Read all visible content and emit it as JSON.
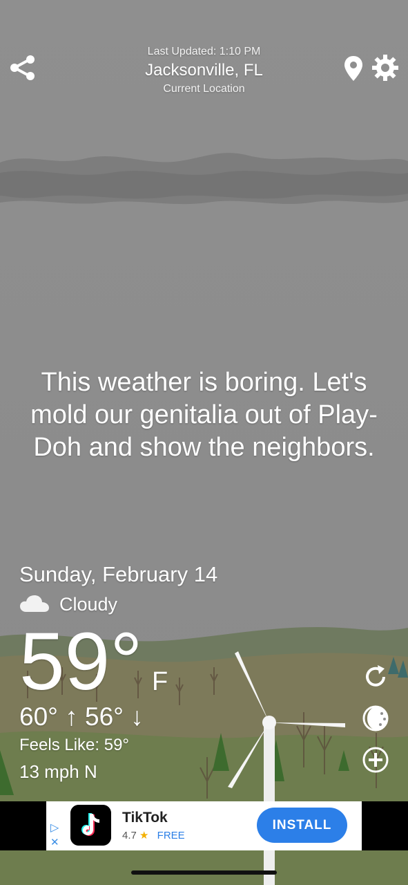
{
  "header": {
    "last_updated": "Last Updated: 1:10 PM",
    "city": "Jacksonville, FL",
    "location_label": "Current Location"
  },
  "icons": {
    "share": "share-icon",
    "pin": "location-pin-icon",
    "settings": "gear-icon",
    "condition": "cloud-icon",
    "refresh": "refresh-icon",
    "moon": "moon-icon",
    "add": "plus-icon"
  },
  "quote": "This weather is boring. Let's mold our genitalia out of Play-Doh and show the neighbors.",
  "weather": {
    "date": "Sunday, February 14",
    "condition": "Cloudy",
    "temperature": "59°",
    "unit": "F",
    "hi_lo": "60° ↑  56° ↓",
    "feels_like": "Feels Like: 59°",
    "wind": "13 mph N"
  },
  "ad": {
    "app_name": "TikTok",
    "rating": "4.7",
    "star": "★",
    "price": "FREE",
    "install_label": "INSTALL",
    "play_icon": "▷",
    "close_icon": "✕"
  },
  "colors": {
    "sky": "#8e8e8e",
    "install_button": "#2c7fe8",
    "ad_accent": "#3a8ee6"
  }
}
